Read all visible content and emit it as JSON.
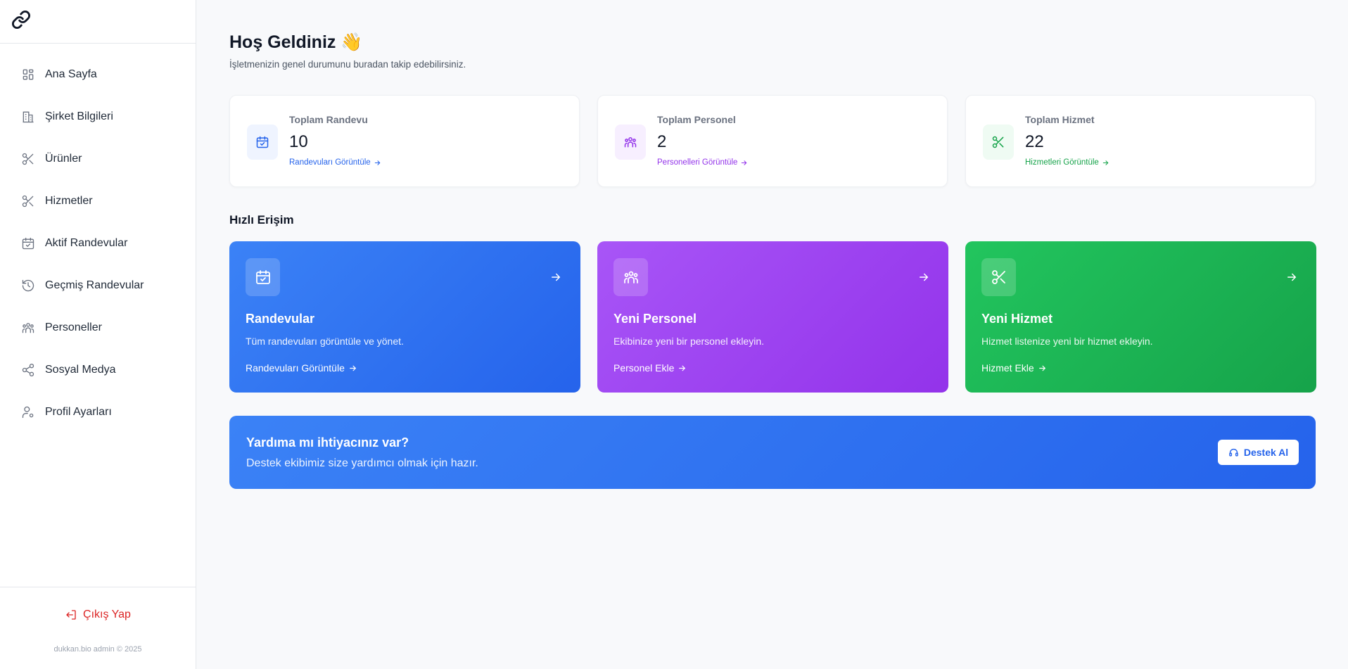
{
  "sidebar": {
    "logo_icon": "link-icon",
    "items": [
      {
        "label": "Ana Sayfa",
        "icon": "dashboard-icon"
      },
      {
        "label": "Şirket Bilgileri",
        "icon": "building-icon"
      },
      {
        "label": "Ürünler",
        "icon": "scissors-icon"
      },
      {
        "label": "Hizmetler",
        "icon": "scissors-icon"
      },
      {
        "label": "Aktif Randevular",
        "icon": "calendar-check-icon"
      },
      {
        "label": "Geçmiş Randevular",
        "icon": "history-icon"
      },
      {
        "label": "Personeller",
        "icon": "users-icon"
      },
      {
        "label": "Sosyal Medya",
        "icon": "share-icon"
      },
      {
        "label": "Profil Ayarları",
        "icon": "user-settings-icon"
      }
    ],
    "logout_label": "Çıkış Yap",
    "copyright": "dukkan.bio admin © 2025"
  },
  "header": {
    "title": "Hoş Geldiniz 👋",
    "subtitle": "İşletmenizin genel durumunu buradan takip edebilirsiniz."
  },
  "stats": [
    {
      "label": "Toplam Randevu",
      "value": "10",
      "link": "Randevuları Görüntüle",
      "color": "#2563eb",
      "bg": "#eff4ff"
    },
    {
      "label": "Toplam Personel",
      "value": "2",
      "link": "Personelleri Görüntüle",
      "color": "#9333ea",
      "bg": "#f7efff"
    },
    {
      "label": "Toplam Hizmet",
      "value": "22",
      "link": "Hizmetleri Görüntüle",
      "color": "#16a34a",
      "bg": "#effbf3"
    }
  ],
  "quick_access": {
    "title": "Hızlı Erişim",
    "cards": [
      {
        "title": "Randevular",
        "desc": "Tüm randevuları görüntüle ve yönet.",
        "link": "Randevuları Görüntüle"
      },
      {
        "title": "Yeni Personel",
        "desc": "Ekibinize yeni bir personel ekleyin.",
        "link": "Personel Ekle"
      },
      {
        "title": "Yeni Hizmet",
        "desc": "Hizmet listenize yeni bir hizmet ekleyin.",
        "link": "Hizmet Ekle"
      }
    ]
  },
  "help": {
    "title": "Yardıma mı ihtiyacınız var?",
    "subtitle": "Destek ekibimiz size yardımcı olmak için hazır.",
    "button": "Destek Al"
  },
  "colors": {
    "blue": "#2563eb",
    "purple": "#9333ea",
    "green": "#16a34a",
    "danger": "#dc2626"
  }
}
